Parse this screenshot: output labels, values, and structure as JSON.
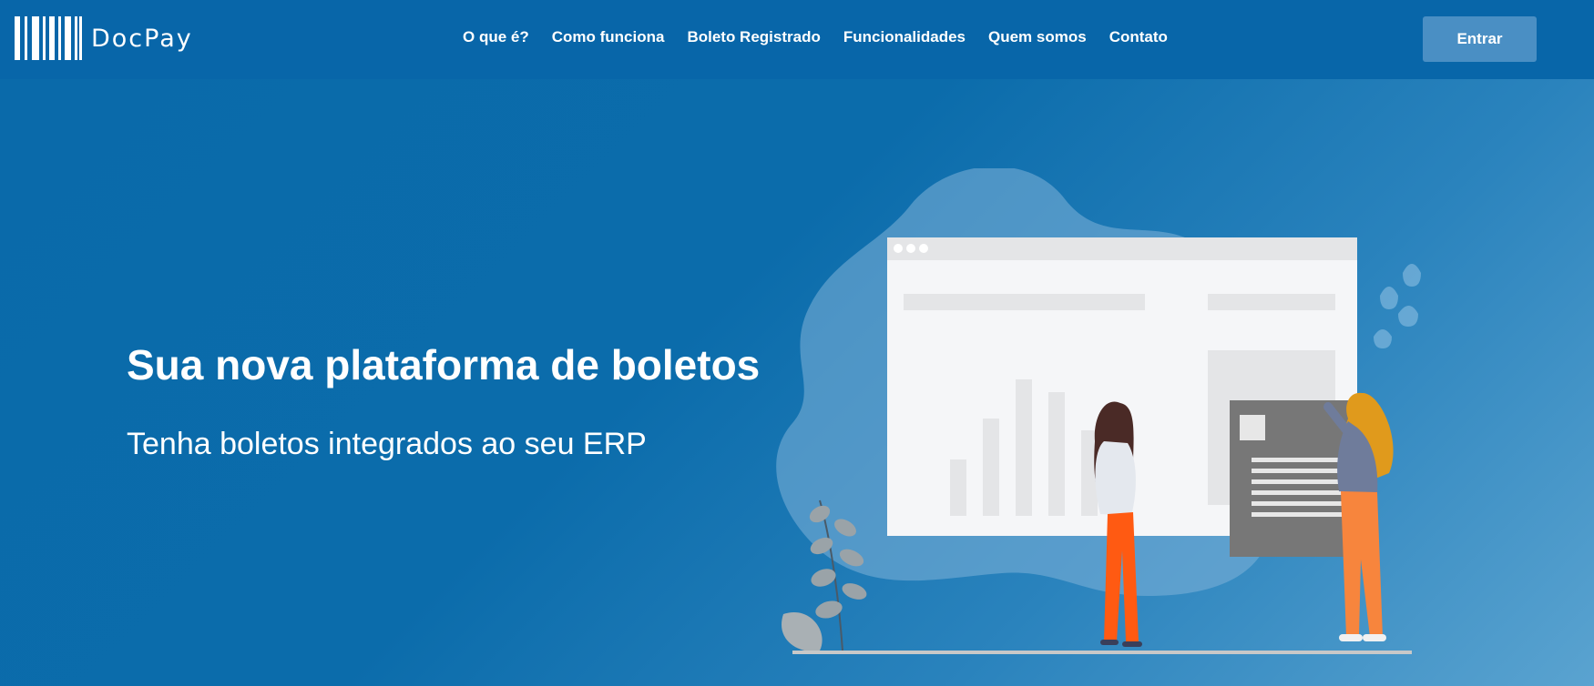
{
  "brand": {
    "name": "DocPay",
    "logo_icon": "barcode-icon"
  },
  "nav": {
    "items": [
      {
        "label": "O que é?"
      },
      {
        "label": "Como funciona"
      },
      {
        "label": "Boleto Registrado"
      },
      {
        "label": "Funcionalidades"
      },
      {
        "label": "Quem somos"
      },
      {
        "label": "Contato"
      }
    ]
  },
  "header": {
    "login_label": "Entrar"
  },
  "hero": {
    "title": "Sua nova plataforma de boletos",
    "subtitle": "Tenha boletos integrados ao seu ERP"
  },
  "colors": {
    "header_bg": "#0866a9",
    "page_bg": "#0b6cab",
    "button_bg": "#4a8fc4",
    "accent_orange": "#ff5a12",
    "accent_yellow": "#e09a1c"
  }
}
